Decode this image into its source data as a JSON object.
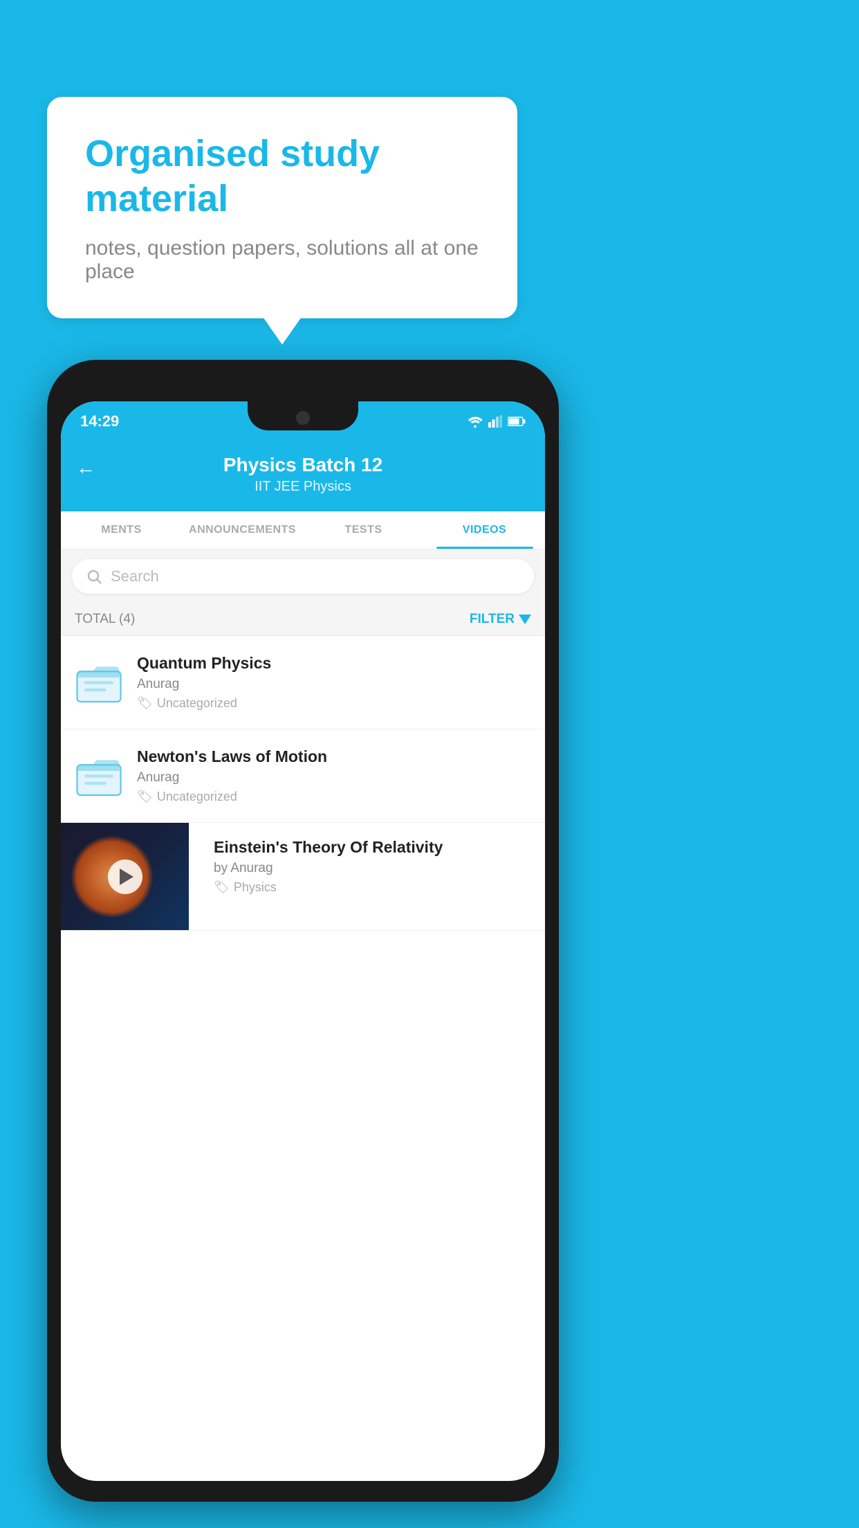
{
  "background": {
    "color": "#1ab8e8"
  },
  "speech_bubble": {
    "title": "Organised study material",
    "subtitle": "notes, question papers, solutions all at one place"
  },
  "phone": {
    "status_bar": {
      "time": "14:29",
      "icons": [
        "wifi",
        "signal",
        "battery"
      ]
    },
    "header": {
      "back_label": "←",
      "title": "Physics Batch 12",
      "subtitle": "IIT JEE    Physics"
    },
    "tabs": [
      {
        "label": "MENTS",
        "active": false
      },
      {
        "label": "ANNOUNCEMENTS",
        "active": false
      },
      {
        "label": "TESTS",
        "active": false
      },
      {
        "label": "VIDEOS",
        "active": true
      }
    ],
    "search": {
      "placeholder": "Search"
    },
    "filter": {
      "total_label": "TOTAL (4)",
      "filter_label": "FILTER"
    },
    "videos": [
      {
        "title": "Quantum Physics",
        "author": "Anurag",
        "tag": "Uncategorized",
        "has_thumbnail": false
      },
      {
        "title": "Newton's Laws of Motion",
        "author": "Anurag",
        "tag": "Uncategorized",
        "has_thumbnail": false
      },
      {
        "title": "Einstein's Theory Of Relativity",
        "author": "by Anurag",
        "tag": "Physics",
        "has_thumbnail": true
      }
    ]
  }
}
